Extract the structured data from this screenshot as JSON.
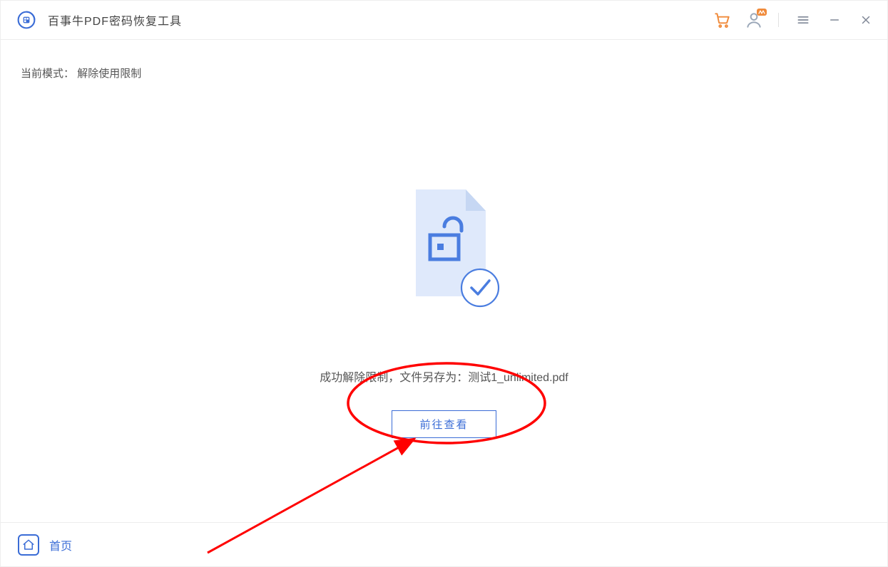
{
  "header": {
    "app_title": "百事牛PDF密码恢复工具"
  },
  "main": {
    "mode_label": "当前模式：",
    "mode_value": "解除使用限制",
    "result_prefix": "成功解除限制，文件另存为：",
    "result_filename": "测试1_unlimited.pdf",
    "view_button": "前往查看"
  },
  "footer": {
    "home": "首页"
  },
  "icons": {
    "cart": "cart-icon",
    "user": "user-icon",
    "menu": "menu-icon",
    "minimize": "minimize-icon",
    "close": "close-icon",
    "home": "home-icon",
    "logo": "app-logo-icon",
    "unlock_doc": "unlocked-document-icon",
    "checkmark": "checkmark-circle-icon"
  }
}
